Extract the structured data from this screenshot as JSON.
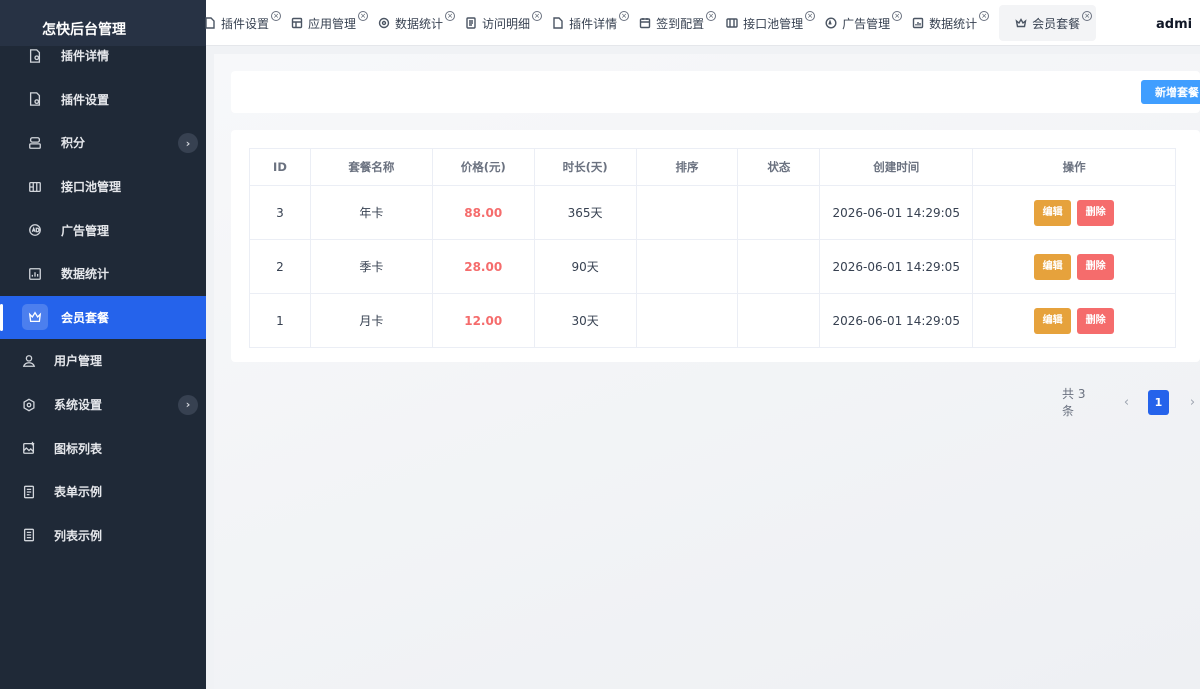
{
  "brand": {
    "title": "怎快后台管理"
  },
  "sidebar": {
    "items": [
      {
        "label": "插件详情",
        "icon": "file-gear-icon",
        "level": "sub"
      },
      {
        "label": "插件设置",
        "icon": "file-settings-icon",
        "level": "sub"
      },
      {
        "label": "积分",
        "icon": "points-icon",
        "level": "sub",
        "has_children": true
      },
      {
        "label": "接口池管理",
        "icon": "api-pool-icon",
        "level": "sub"
      },
      {
        "label": "广告管理",
        "icon": "ad-icon",
        "level": "sub"
      },
      {
        "label": "数据统计",
        "icon": "chart-icon",
        "level": "sub"
      },
      {
        "label": "会员套餐",
        "icon": "crown-icon",
        "level": "sub",
        "active": true
      },
      {
        "label": "用户管理",
        "icon": "user-icon",
        "level": "top"
      },
      {
        "label": "系统设置",
        "icon": "settings-icon",
        "level": "top",
        "has_children": true
      },
      {
        "label": "图标列表",
        "icon": "image-icon",
        "level": "top"
      },
      {
        "label": "表单示例",
        "icon": "form-icon",
        "level": "top"
      },
      {
        "label": "列表示例",
        "icon": "list-icon",
        "level": "top"
      }
    ],
    "chevron": "›"
  },
  "tabs": [
    {
      "label": "插件设置",
      "icon": "file-settings-icon"
    },
    {
      "label": "应用管理",
      "icon": "app-icon"
    },
    {
      "label": "数据统计",
      "icon": "stats-icon"
    },
    {
      "label": "访问明细",
      "icon": "doc-icon"
    },
    {
      "label": "插件详情",
      "icon": "file-gear-icon"
    },
    {
      "label": "签到配置",
      "icon": "calendar-icon"
    },
    {
      "label": "接口池管理",
      "icon": "api-pool-icon"
    },
    {
      "label": "广告管理",
      "icon": "ad-icon"
    },
    {
      "label": "数据统计",
      "icon": "chart-icon"
    },
    {
      "label": "会员套餐",
      "icon": "crown-icon",
      "active": true
    }
  ],
  "tab_close": "×",
  "user": {
    "name": "admi"
  },
  "toolbar": {
    "add_label": "新增套餐"
  },
  "table": {
    "headers": [
      "ID",
      "套餐名称",
      "价格(元)",
      "时长(天)",
      "排序",
      "状态",
      "创建时间",
      "操作"
    ],
    "rows": [
      {
        "id": "3",
        "name": "年卡",
        "price": "88.00",
        "duration": "365天",
        "sort": "",
        "status": "",
        "created": "2026-06-01 14:29:05"
      },
      {
        "id": "2",
        "name": "季卡",
        "price": "28.00",
        "duration": "90天",
        "sort": "",
        "status": "",
        "created": "2026-06-01 14:29:05"
      },
      {
        "id": "1",
        "name": "月卡",
        "price": "12.00",
        "duration": "30天",
        "sort": "",
        "status": "",
        "created": "2026-06-01 14:29:05"
      }
    ],
    "edit_label": "编辑",
    "delete_label": "删除"
  },
  "pagination": {
    "total_text": "共 3 条",
    "current_page": "1",
    "prev": "‹",
    "next": "›"
  },
  "colors": {
    "sidebar_bg": "#1f2937",
    "active": "#2563eb",
    "primary_button": "#409eff",
    "edit_button": "#e6a23c",
    "delete_button": "#f56c6c",
    "price_text": "#f56c6c"
  }
}
